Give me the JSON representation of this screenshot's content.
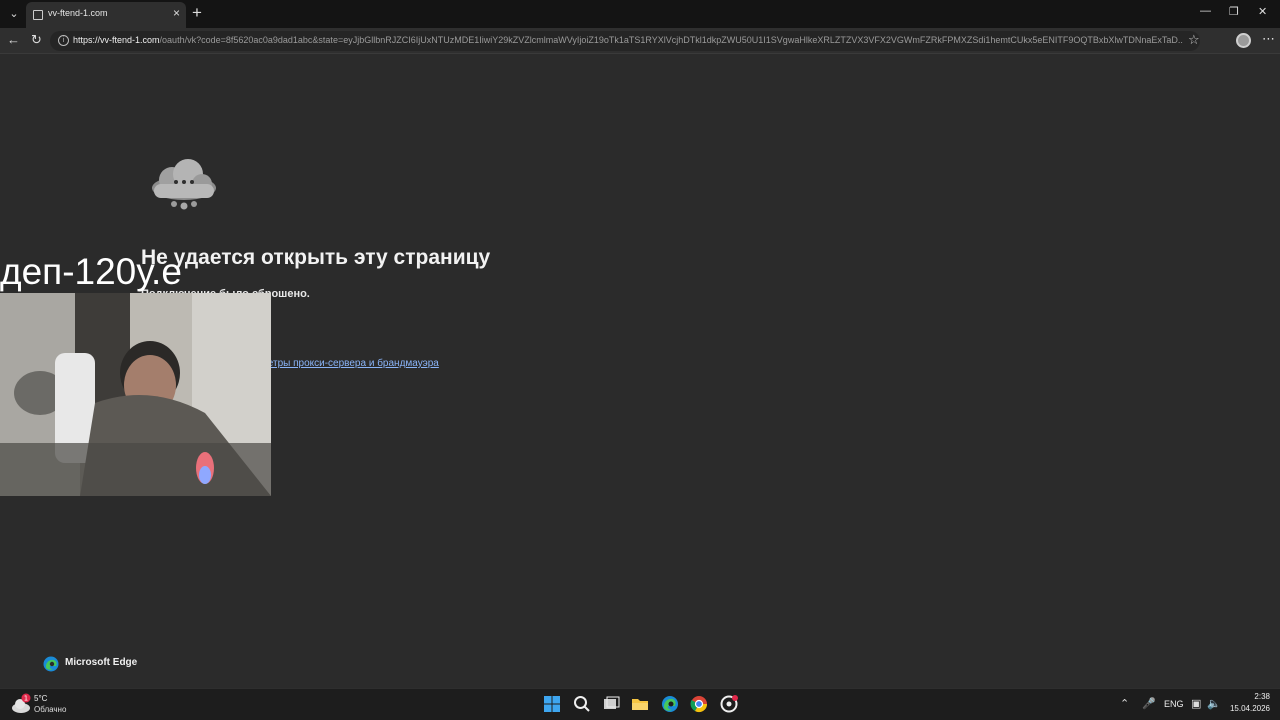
{
  "browser": {
    "tab_title": "vv-ftend-1.com",
    "tab_close": "×",
    "new_tab": "+",
    "url_host": "https://vv-ftend-1.com",
    "url_path": "/oauth/vk?code=8f5620ac0a9dad1abc&state=eyJjbGllbnRJZCI6IjUxNTUzMDE1IiwiY29kZVZlcmlmaWVyIjoiZ19oTk1aTS1RYXlVcjhDTkl1dkpZWU50U1I1SVgwaHlkeXRLZTZVX3VFX2VGWmFZRkFPMXZSdi1hemtCUkx5eENITF9OQTBxbXlwTDNnaExTaD...",
    "icons": {
      "tab_actions": "chevron-down-icon",
      "back": "back-arrow-icon",
      "refresh": "refresh-icon",
      "site_info": "info-icon",
      "favorite": "star-icon",
      "profile": "profile-icon",
      "more": "more-icon",
      "minimize": "minimize-icon",
      "restore": "restore-icon",
      "close": "close-icon"
    }
  },
  "page": {
    "title": "Не удается открыть эту страницу",
    "subtitle": "Подключение было сброшено.",
    "link_text": "Проверить параметры прокси-сервера и брандмауэра",
    "brand_label": "Microsoft Edge"
  },
  "stream_overlay": {
    "text": "деп-120у.е"
  },
  "taskbar": {
    "weather_temp": "5°C",
    "weather_desc": "Облачно",
    "weather_badge": "1",
    "language": "ENG",
    "time": "2:38",
    "date": "15.04.2026",
    "apps": [
      "start-icon",
      "search-icon",
      "task-view-icon",
      "file-explorer-icon",
      "edge-icon",
      "chrome-icon",
      "app-icon"
    ]
  },
  "colors": {
    "page_bg": "#2b2b2b",
    "link": "#8ab4f8",
    "taskbar_bg": "#1d1d1d"
  }
}
